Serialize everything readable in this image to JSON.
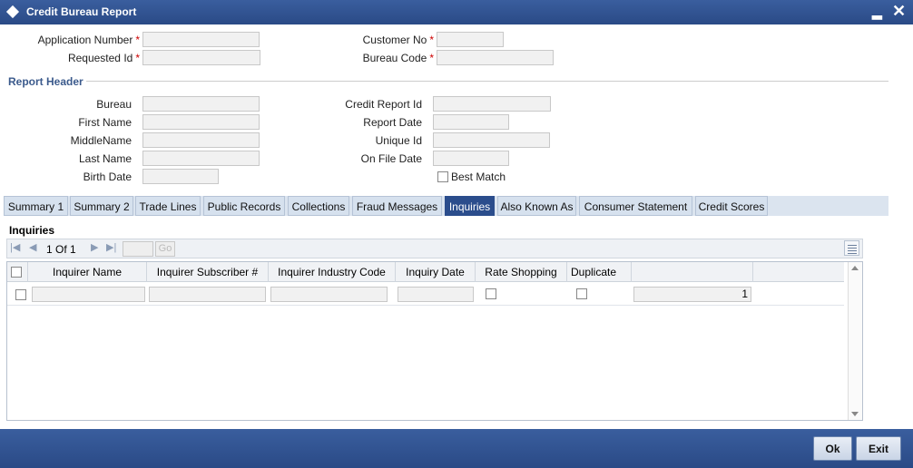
{
  "window": {
    "title": "Credit Bureau Report"
  },
  "fields": {
    "application_number": {
      "label": "Application Number",
      "value": ""
    },
    "customer_no": {
      "label": "Customer No",
      "value": ""
    },
    "requested_id": {
      "label": "Requested Id",
      "value": ""
    },
    "bureau_code": {
      "label": "Bureau Code",
      "value": ""
    },
    "required_marker": "*"
  },
  "report_header": {
    "title": "Report Header",
    "bureau": {
      "label": "Bureau",
      "value": ""
    },
    "first_name": {
      "label": "First Name",
      "value": ""
    },
    "middle_name": {
      "label": "MiddleName",
      "value": ""
    },
    "last_name": {
      "label": "Last Name",
      "value": ""
    },
    "birth_date": {
      "label": "Birth Date",
      "value": ""
    },
    "credit_report_id": {
      "label": "Credit Report Id",
      "value": ""
    },
    "report_date": {
      "label": "Report Date",
      "value": ""
    },
    "unique_id": {
      "label": "Unique Id",
      "value": ""
    },
    "on_file_date": {
      "label": "On File Date",
      "value": ""
    },
    "best_match": {
      "label": "Best Match",
      "checked": false
    }
  },
  "tabs": [
    {
      "label": "Summary 1"
    },
    {
      "label": "Summary 2"
    },
    {
      "label": "Trade Lines"
    },
    {
      "label": "Public Records"
    },
    {
      "label": "Collections"
    },
    {
      "label": "Fraud Messages"
    },
    {
      "label": "Inquiries",
      "active": true
    },
    {
      "label": "Also Known As"
    },
    {
      "label": "Consumer Statement"
    },
    {
      "label": "Credit Scores"
    }
  ],
  "inquiries": {
    "title": "Inquiries",
    "pager": {
      "current": "1",
      "of_label": "Of",
      "total": "1",
      "go_label": "Go"
    },
    "columns": [
      "Inquirer Name",
      "Inquirer Subscriber #",
      "Inquirer Industry Code",
      "Inquiry Date",
      "Rate Shopping",
      "Duplicate"
    ],
    "rows": [
      {
        "inquirer_name": "",
        "subscriber": "",
        "industry_code": "",
        "inquiry_date": "",
        "rate_shopping": false,
        "duplicate": false,
        "count": "1"
      }
    ]
  },
  "buttons": {
    "ok": "Ok",
    "exit": "Exit"
  },
  "colors": {
    "titlebar": "#2f5090",
    "active_tab": "#2b4d8c",
    "section": "#3b5a8c",
    "required": "#cc0000"
  },
  "icons": [
    "app-diamond-icon",
    "minimize-icon",
    "close-icon",
    "first-page-icon",
    "prev-page-icon",
    "next-page-icon",
    "last-page-icon",
    "grid-menu-icon",
    "scroll-up-icon",
    "scroll-down-icon"
  ]
}
